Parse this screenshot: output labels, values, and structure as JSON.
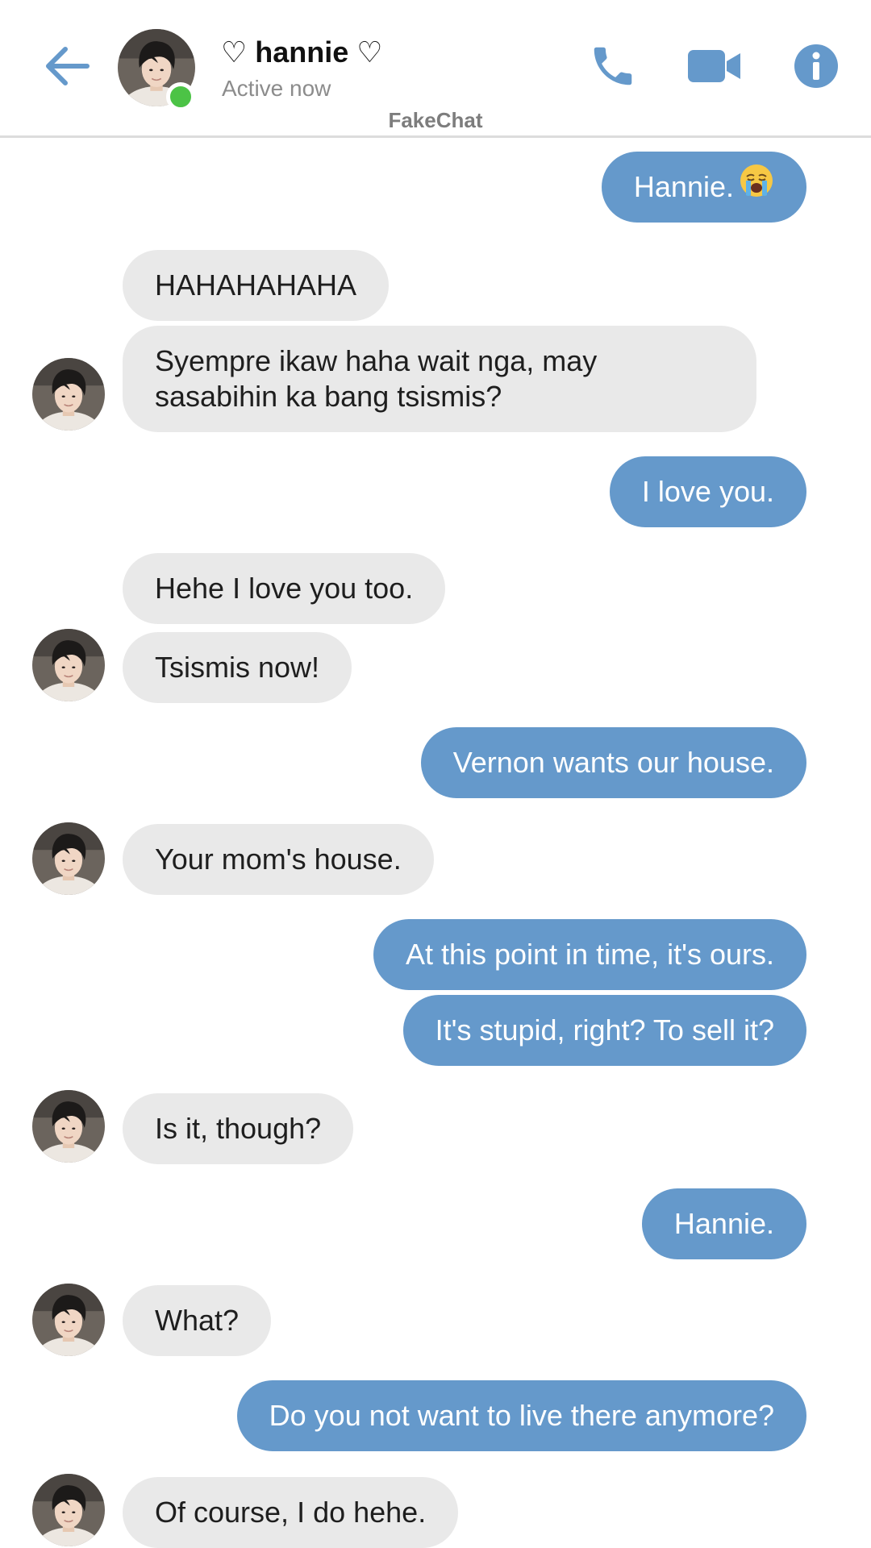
{
  "header": {
    "contact_name": "♡ hannie ♡",
    "status": "Active now",
    "watermark": "FakeChat",
    "accent_color": "#6599cb",
    "online_color": "#4cc346",
    "icons": [
      "back-arrow-icon",
      "phone-icon",
      "video-camera-icon",
      "info-icon"
    ]
  },
  "colors": {
    "sent_bubble": "#6599cb",
    "received_bubble": "#e9e9e9"
  },
  "messages": [
    {
      "from": "me",
      "text": "Hannie.",
      "emoji": "loudly-crying-face"
    },
    {
      "from": "them",
      "text": "HAHAHAHAHA"
    },
    {
      "from": "them",
      "text": "Syempre ikaw haha wait nga, may sasabihin ka bang tsismis?"
    },
    {
      "from": "me",
      "text": "I love you."
    },
    {
      "from": "them",
      "text": "Hehe I love you too."
    },
    {
      "from": "them",
      "text": "Tsismis now!"
    },
    {
      "from": "me",
      "text": "Vernon wants our house."
    },
    {
      "from": "them",
      "text": "Your mom's house."
    },
    {
      "from": "me",
      "text": "At this point in time, it's ours."
    },
    {
      "from": "me",
      "text": "It's stupid, right? To sell it?"
    },
    {
      "from": "them",
      "text": "Is it, though?"
    },
    {
      "from": "me",
      "text": "Hannie."
    },
    {
      "from": "them",
      "text": "What?"
    },
    {
      "from": "me",
      "text": "Do you not want to live there anymore?"
    },
    {
      "from": "them",
      "text": "Of course, I do hehe."
    }
  ]
}
